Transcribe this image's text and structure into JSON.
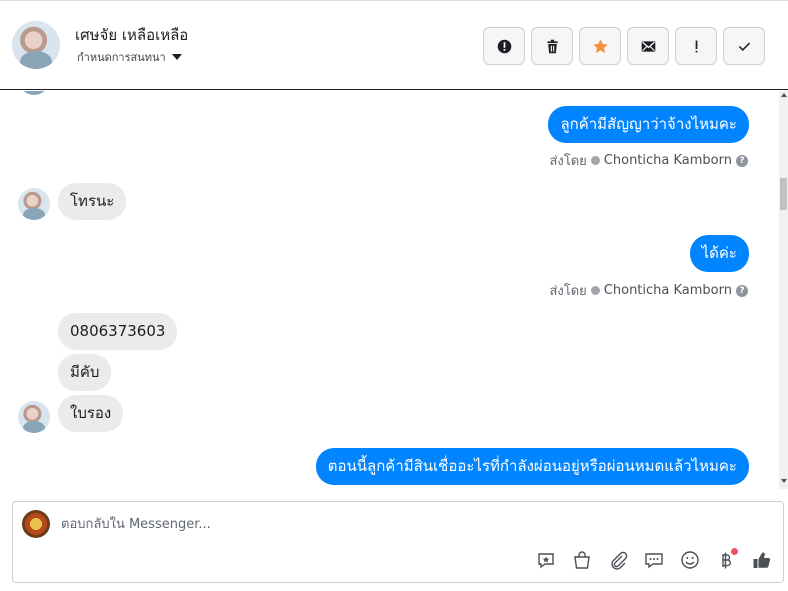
{
  "header": {
    "contact_name": "เศษจัย เหลือเหลือ",
    "status_label": "กำหนดการสนทนา",
    "actions": [
      {
        "name": "spam",
        "icon": "alert-circle-icon"
      },
      {
        "name": "delete",
        "icon": "trash-icon"
      },
      {
        "name": "star",
        "icon": "star-icon",
        "color": "#f7923b"
      },
      {
        "name": "mark-unread",
        "icon": "envelope-icon"
      },
      {
        "name": "follow-up",
        "icon": "exclamation-icon"
      },
      {
        "name": "done",
        "icon": "check-icon"
      }
    ]
  },
  "messages": {
    "m1": {
      "text": "ลูกค้ามีสัญญาว่าจ้างไหมคะ",
      "sent_prefix": "ส่งโดย",
      "agent": "Chonticha Kamborn"
    },
    "m2": {
      "text": "โทรนะ"
    },
    "m3": {
      "text": "ได้ค่ะ",
      "sent_prefix": "ส่งโดย",
      "agent": "Chonticha Kamborn"
    },
    "m4": {
      "text": "0806373603"
    },
    "m5": {
      "text": "มีคับ"
    },
    "m6": {
      "text": "ใบรอง"
    },
    "m7": {
      "text": "ตอนนี้ลูกค้ามีสินเชื่ออะไรที่กำลังผ่อนอยู่หรือผ่อนหมดแล้วไหมคะ"
    }
  },
  "composer": {
    "placeholder": "ตอบกลับใน Messenger...",
    "tools": [
      "saved-reply-icon",
      "shop-bag-icon",
      "paperclip-icon",
      "chat-bubble-icon",
      "emoji-icon",
      "baht-icon",
      "thumbs-up-icon"
    ]
  },
  "colors": {
    "outgoing": "#0084ff",
    "incoming": "#ebebeb",
    "accent_star": "#f7923b",
    "notification_dot": "#f25268"
  }
}
